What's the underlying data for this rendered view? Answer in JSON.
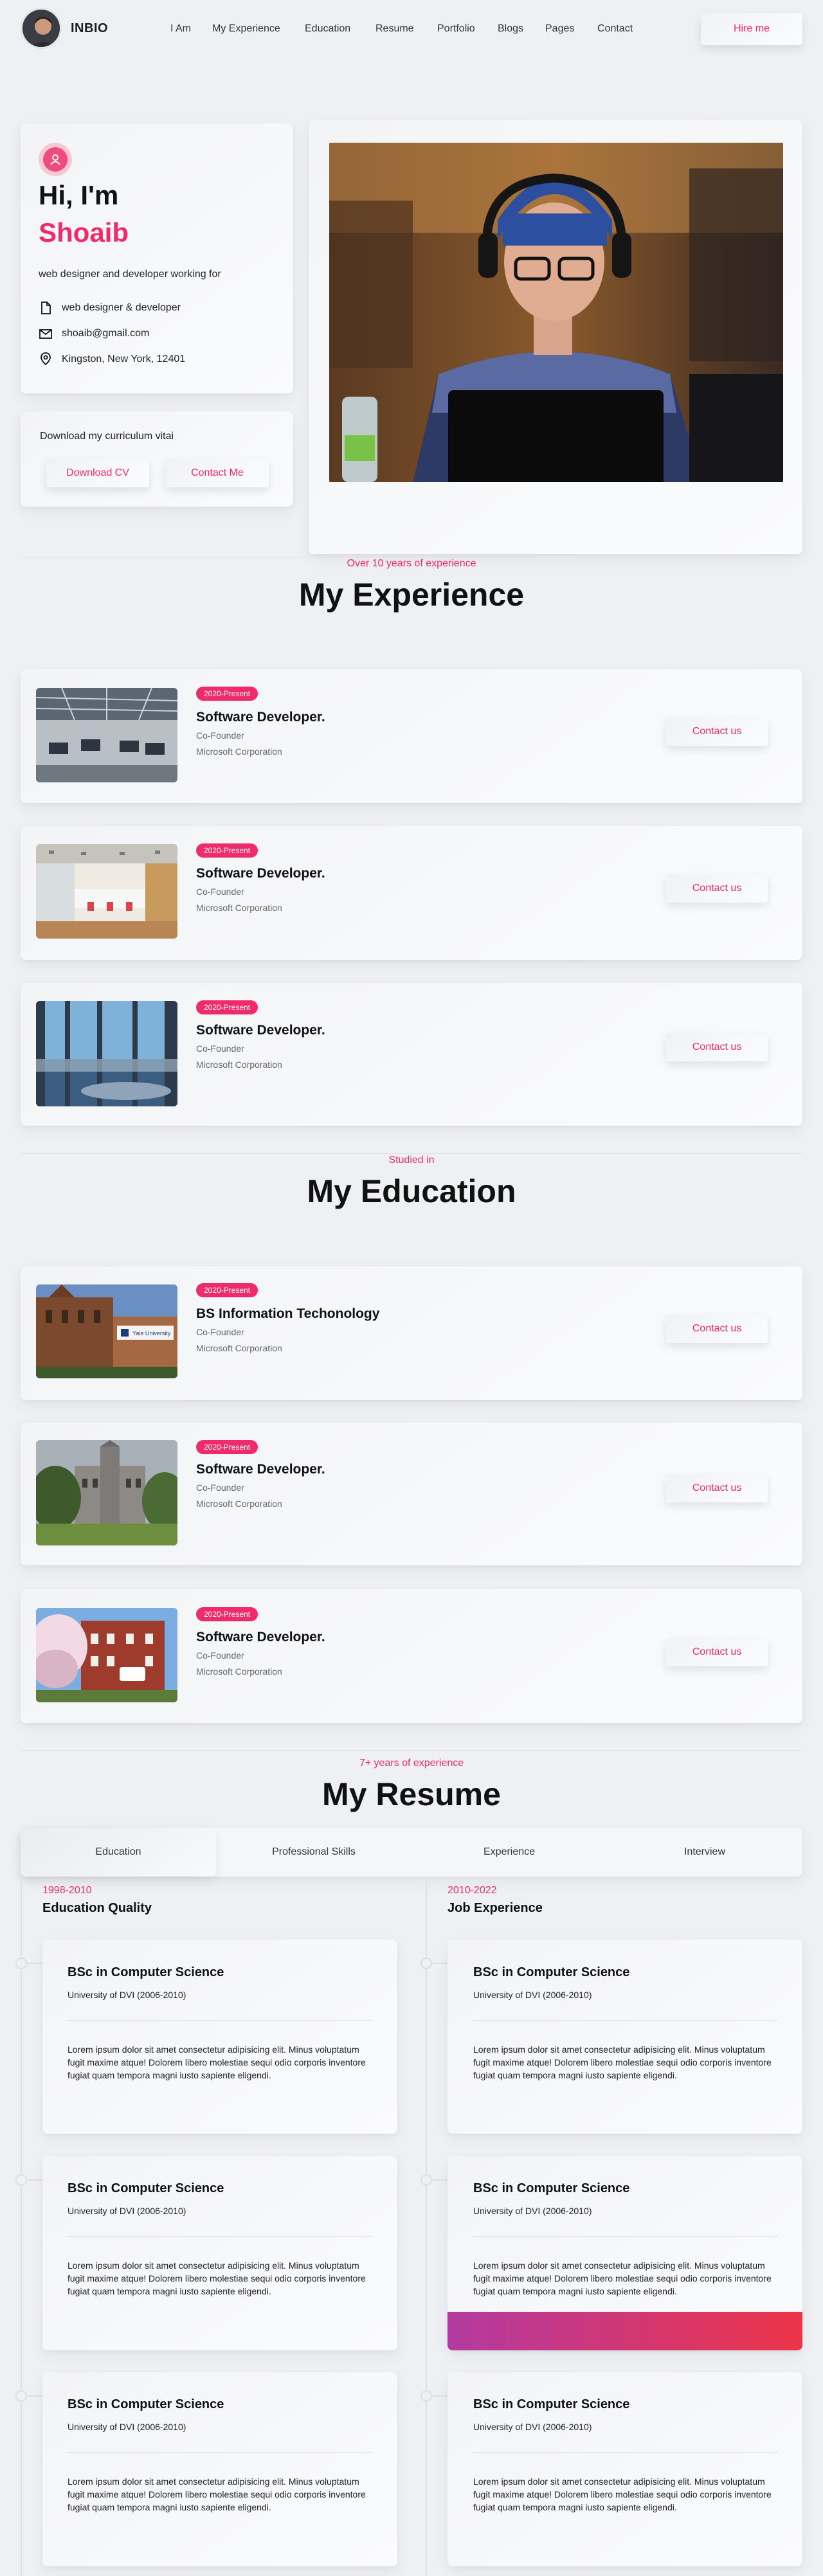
{
  "header": {
    "logo": "INBIO",
    "nav": [
      "I Am",
      "My Experience",
      "Education",
      "Resume",
      "Portfolio",
      "Blogs",
      "Pages",
      "Contact"
    ],
    "hire_label": "Hire me"
  },
  "hero": {
    "greeting": "Hi, I'm",
    "name": "Shoaib",
    "intro": "web designer and developer working for",
    "info": [
      {
        "icon": "file-icon",
        "text": "web designer & developer"
      },
      {
        "icon": "mail-icon",
        "text": "shoaib@gmail.com"
      },
      {
        "icon": "location-icon",
        "text": "Kingston, New York, 12401"
      }
    ],
    "cv_label": "Download my curriculum vitai",
    "download_label": "Download CV",
    "contact_label": "Contact Me"
  },
  "experience": {
    "subtitle": "Over 10 years of experience",
    "title": "My Experience",
    "items": [
      {
        "badge": "2020-Present",
        "title": "Software Developer.",
        "role": "Co-Founder",
        "company": "Microsoft Corporation",
        "button": "Contact us"
      },
      {
        "badge": "2020-Present",
        "title": "Software Developer.",
        "role": "Co-Founder",
        "company": "Microsoft Corporation",
        "button": "Contact us"
      },
      {
        "badge": "2020-Present",
        "title": "Software Developer.",
        "role": "Co-Founder",
        "company": "Microsoft Corporation",
        "button": "Contact us"
      }
    ]
  },
  "education": {
    "subtitle": "Studied in",
    "title": "My Education",
    "items": [
      {
        "badge": "2020-Present",
        "title": "BS Information Techonology",
        "role": "Co-Founder",
        "company": "Microsoft Corporation",
        "button": "Contact us",
        "sign": "Yale University"
      },
      {
        "badge": "2020-Present",
        "title": "Software Developer.",
        "role": "Co-Founder",
        "company": "Microsoft Corporation",
        "button": "Contact us"
      },
      {
        "badge": "2020-Present",
        "title": "Software Developer.",
        "role": "Co-Founder",
        "company": "Microsoft Corporation",
        "button": "Contact us"
      }
    ]
  },
  "resume": {
    "subtitle": "7+ years of experience",
    "title": "My Resume",
    "tabs": [
      "Education",
      "Professional Skills",
      "Experience",
      "Interview"
    ],
    "left": {
      "date": "1998-2010",
      "heading": "Education Quality"
    },
    "right": {
      "date": "2010-2022",
      "heading": "Job Experience"
    },
    "card": {
      "title": "BSc in Computer Science",
      "university": "University of DVI (2006-2010)",
      "body": "Lorem ipsum dolor sit amet consectetur adipisicing elit. Minus voluptatum fugit maxime atque! Dolorem libero molestiae sequi odio corporis inventore fugiat quam tempora magni iusto sapiente eligendi."
    }
  },
  "colors": {
    "accent": "#ef2b6b",
    "background": "#eef0f3",
    "gradient_start": "#b33aa1",
    "gradient_end": "#ec3448"
  }
}
